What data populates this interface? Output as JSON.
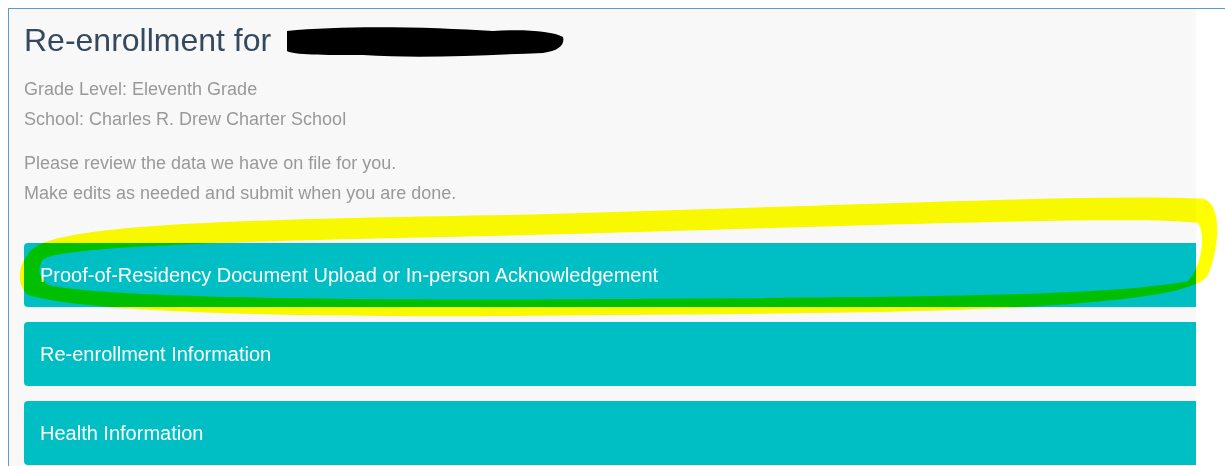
{
  "title": "Re-enrollment for",
  "details": [
    "Grade Level: Eleventh Grade",
    "School: Charles R. Drew Charter School"
  ],
  "instructions": [
    "Please review the data we have on file for you.",
    "Make edits as needed and submit when you are done."
  ],
  "sections": [
    {
      "label": "Proof-of-Residency Document Upload or In-person Acknowledgement",
      "highlighted": true
    },
    {
      "label": "Re-enrollment Information",
      "highlighted": false
    },
    {
      "label": "Health Information",
      "highlighted": false
    }
  ]
}
